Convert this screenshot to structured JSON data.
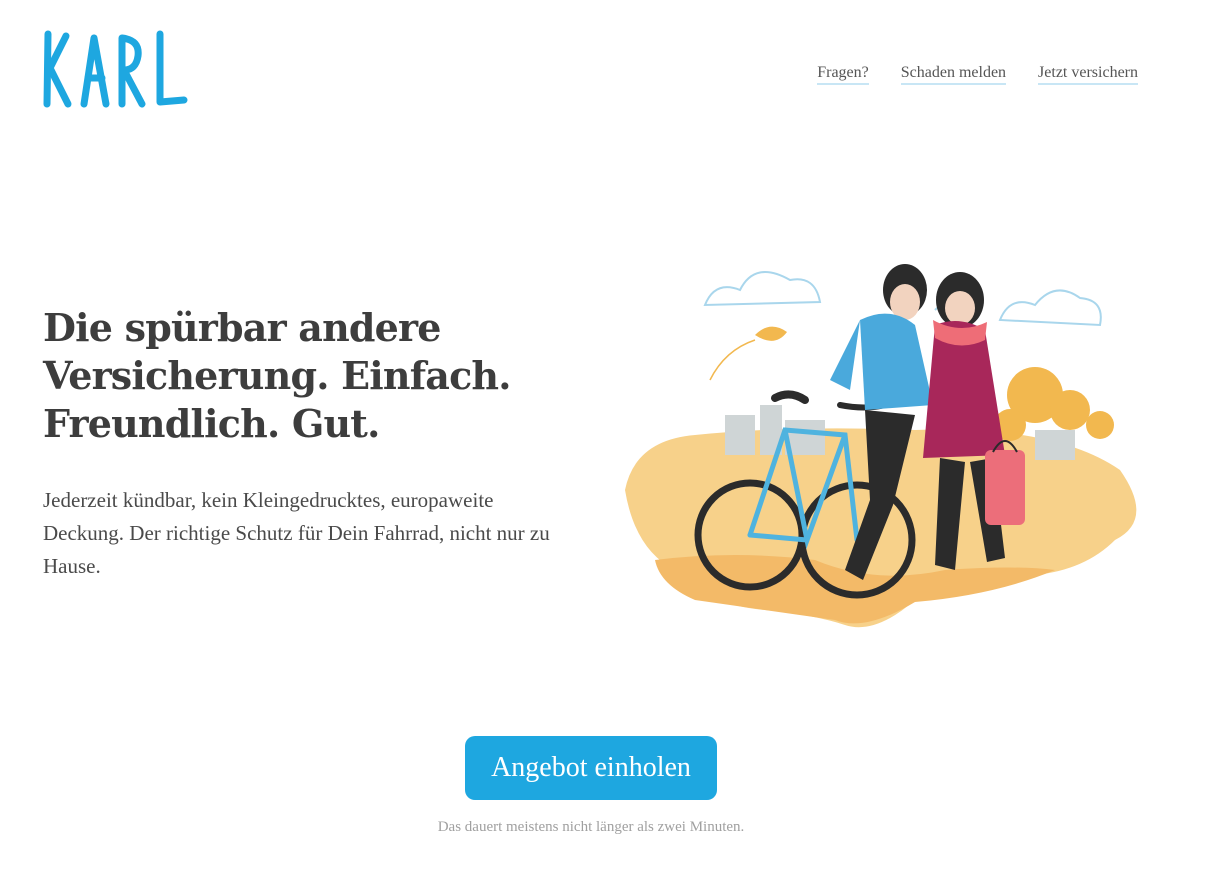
{
  "brand": {
    "logo_text": "KARL",
    "color": "#1ea7e0"
  },
  "nav": {
    "items": [
      {
        "label": "Fragen?"
      },
      {
        "label": "Schaden melden"
      },
      {
        "label": "Jetzt versichern"
      }
    ]
  },
  "hero": {
    "headline": "Die spürbar andere Versicherung. Einfach. Freundlich. Gut.",
    "subtext": "Jederzeit kündbar, kein Kleingedrucktes, europaweite Deckung. Der richtige Schutz für Dein Fahrrad, nicht nur zu Hause."
  },
  "cta": {
    "label": "Angebot einholen",
    "note": "Das dauert meistens nicht länger als zwei Minuten."
  },
  "colors": {
    "accent": "#1ea7e0",
    "text": "#3d3d3d",
    "muted": "#a0a0a0"
  }
}
